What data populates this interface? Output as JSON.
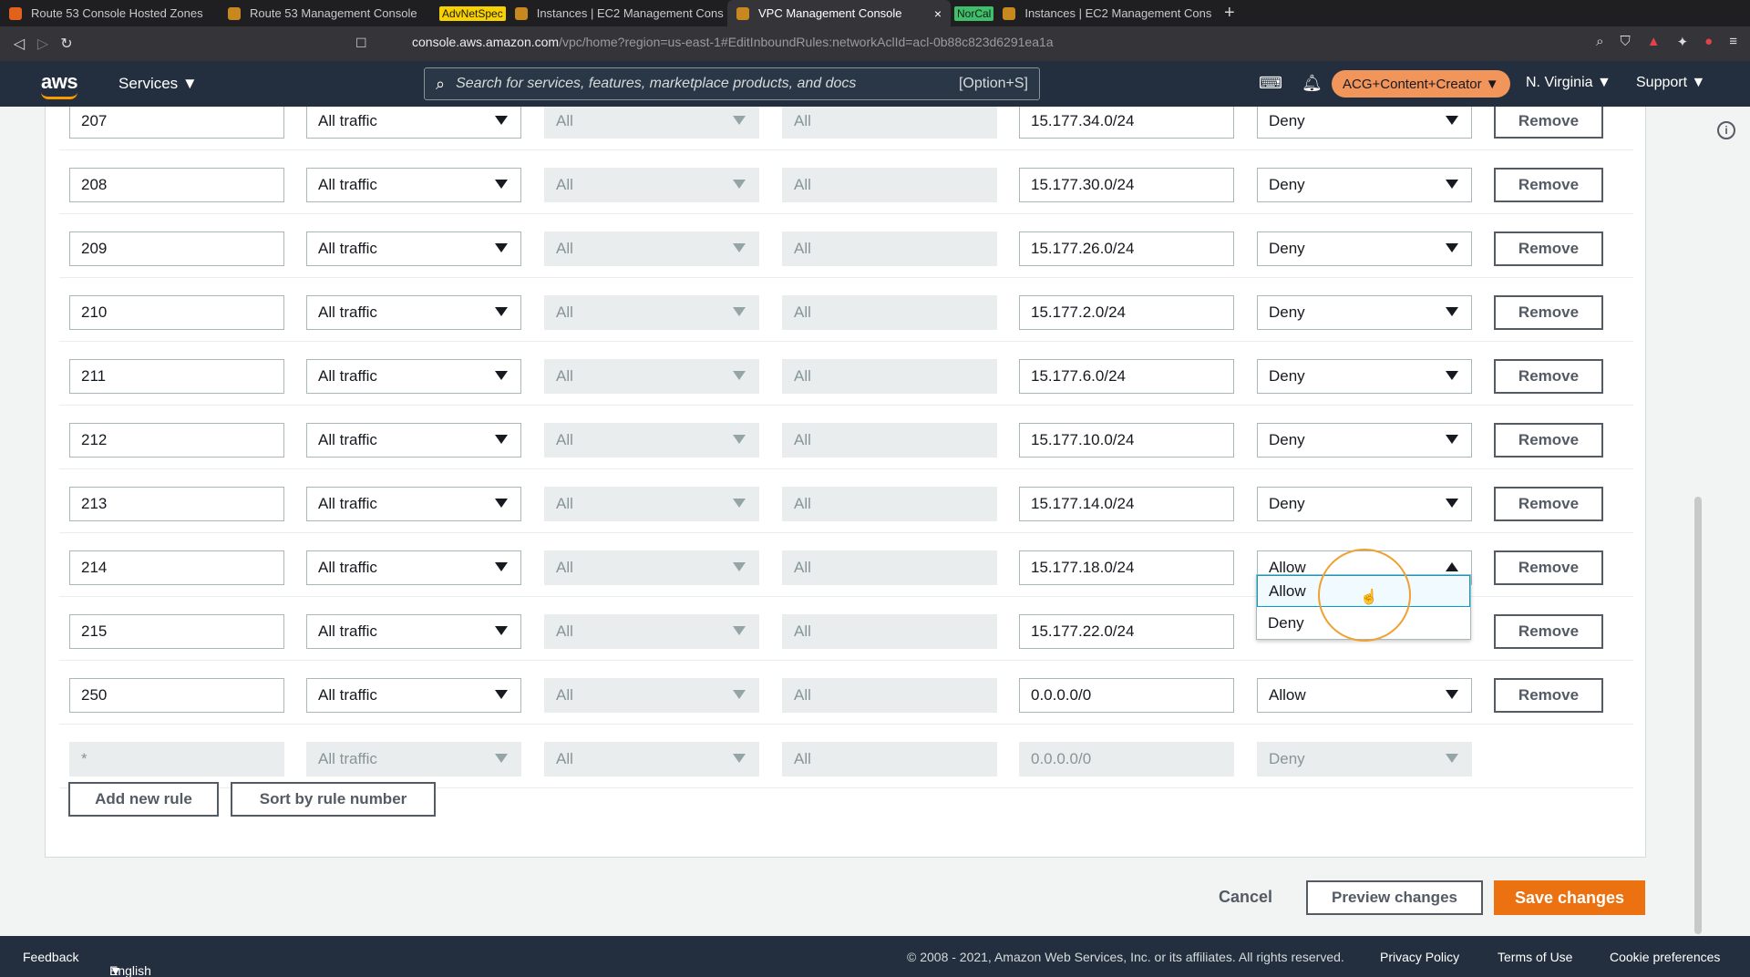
{
  "browser": {
    "tabs": [
      {
        "label": "Route 53 Console Hosted Zones",
        "tag": "",
        "tag_color": ""
      },
      {
        "label": "Route 53 Management Console",
        "tag": "",
        "tag_color": ""
      },
      {
        "label": "Instances | EC2 Management Cons",
        "tag": "AdvNetSpec",
        "tag_color": "#f7d100"
      },
      {
        "label": "VPC Management Console",
        "tag": "",
        "tag_color": ""
      },
      {
        "label": "Instances | EC2 Management Cons",
        "tag": "NorCal",
        "tag_color": "#3fbf6a"
      }
    ],
    "new_tab": "+",
    "close_tab": "×",
    "url_host": "console.aws.amazon.com",
    "url_path": "/vpc/home?region=us-east-1#EditInboundRules:networkAclId=acl-0b88c823d6291ea1a"
  },
  "aws_header": {
    "logo": "aws",
    "services": "Services",
    "search_placeholder": "Search for services, features, marketplace products, and docs",
    "search_shortcut": "[Option+S]",
    "account": "ACG+Content+Creator",
    "region": "N. Virginia",
    "support": "Support"
  },
  "rules": [
    {
      "number": "207",
      "type": "All traffic",
      "protocol": "All",
      "port": "All",
      "source": "15.177.34.0/24",
      "action": "Deny",
      "remove": "Remove"
    },
    {
      "number": "208",
      "type": "All traffic",
      "protocol": "All",
      "port": "All",
      "source": "15.177.30.0/24",
      "action": "Deny",
      "remove": "Remove"
    },
    {
      "number": "209",
      "type": "All traffic",
      "protocol": "All",
      "port": "All",
      "source": "15.177.26.0/24",
      "action": "Deny",
      "remove": "Remove"
    },
    {
      "number": "210",
      "type": "All traffic",
      "protocol": "All",
      "port": "All",
      "source": "15.177.2.0/24",
      "action": "Deny",
      "remove": "Remove"
    },
    {
      "number": "211",
      "type": "All traffic",
      "protocol": "All",
      "port": "All",
      "source": "15.177.6.0/24",
      "action": "Deny",
      "remove": "Remove"
    },
    {
      "number": "212",
      "type": "All traffic",
      "protocol": "All",
      "port": "All",
      "source": "15.177.10.0/24",
      "action": "Deny",
      "remove": "Remove"
    },
    {
      "number": "213",
      "type": "All traffic",
      "protocol": "All",
      "port": "All",
      "source": "15.177.14.0/24",
      "action": "Deny",
      "remove": "Remove"
    },
    {
      "number": "214",
      "type": "All traffic",
      "protocol": "All",
      "port": "All",
      "source": "15.177.18.0/24",
      "action": "Allow",
      "remove": "Remove"
    },
    {
      "number": "215",
      "type": "All traffic",
      "protocol": "All",
      "port": "All",
      "source": "15.177.22.0/24",
      "action": "",
      "remove": "Remove"
    },
    {
      "number": "250",
      "type": "All traffic",
      "protocol": "All",
      "port": "All",
      "source": "0.0.0.0/0",
      "action": "Allow",
      "remove": "Remove"
    },
    {
      "number": "*",
      "type": "All traffic",
      "protocol": "All",
      "port": "All",
      "source": "0.0.0.0/0",
      "action": "Deny",
      "remove": ""
    }
  ],
  "action_dropdown": {
    "options": [
      "Allow",
      "Deny"
    ],
    "highlighted": "Allow"
  },
  "buttons": {
    "add_rule": "Add new rule",
    "sort": "Sort by rule number",
    "cancel": "Cancel",
    "preview": "Preview changes",
    "save": "Save changes"
  },
  "footer": {
    "feedback": "Feedback",
    "language": "English (US)",
    "copyright": "© 2008 - 2021, Amazon Web Services, Inc. or its affiliates. All rights reserved.",
    "privacy": "Privacy Policy",
    "terms": "Terms of Use",
    "cookies": "Cookie preferences"
  },
  "colors": {
    "aws_nav": "#232f3e",
    "primary": "#ec7211",
    "account_pill": "#f1955b"
  }
}
